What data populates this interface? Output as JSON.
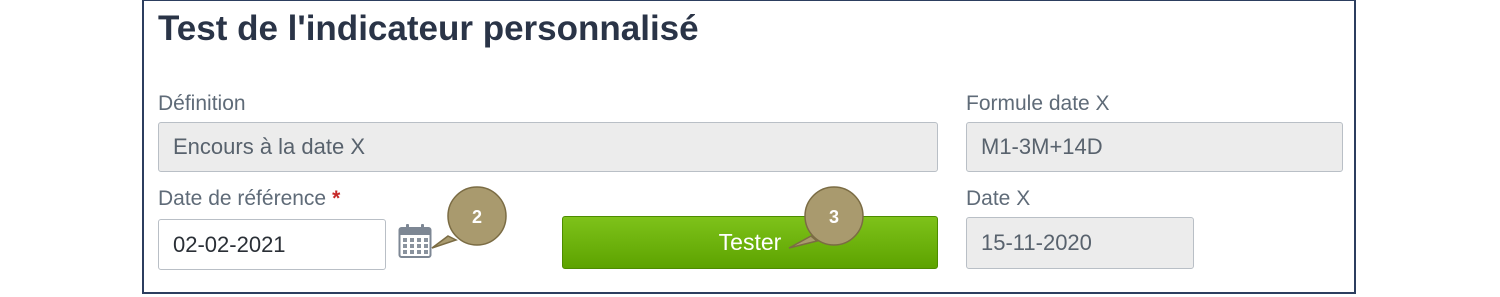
{
  "panel": {
    "title": "Test de l'indicateur personnalisé"
  },
  "definition": {
    "label": "Définition",
    "value": "Encours à la date X"
  },
  "formula": {
    "label": "Formule date X",
    "value": "M1-3M+14D"
  },
  "reference_date": {
    "label": "Date de référence",
    "required_mark": "*",
    "value": "02-02-2021"
  },
  "date_x": {
    "label": "Date X",
    "value": "15-11-2020"
  },
  "actions": {
    "test_label": "Tester"
  },
  "callouts": {
    "first": "2",
    "second": "3"
  },
  "colors": {
    "accent_green": "#6cb30c",
    "border_navy": "#2c3e5f",
    "callout_fill": "#a99a6e"
  },
  "icons": {
    "calendar": "calendar-icon"
  }
}
